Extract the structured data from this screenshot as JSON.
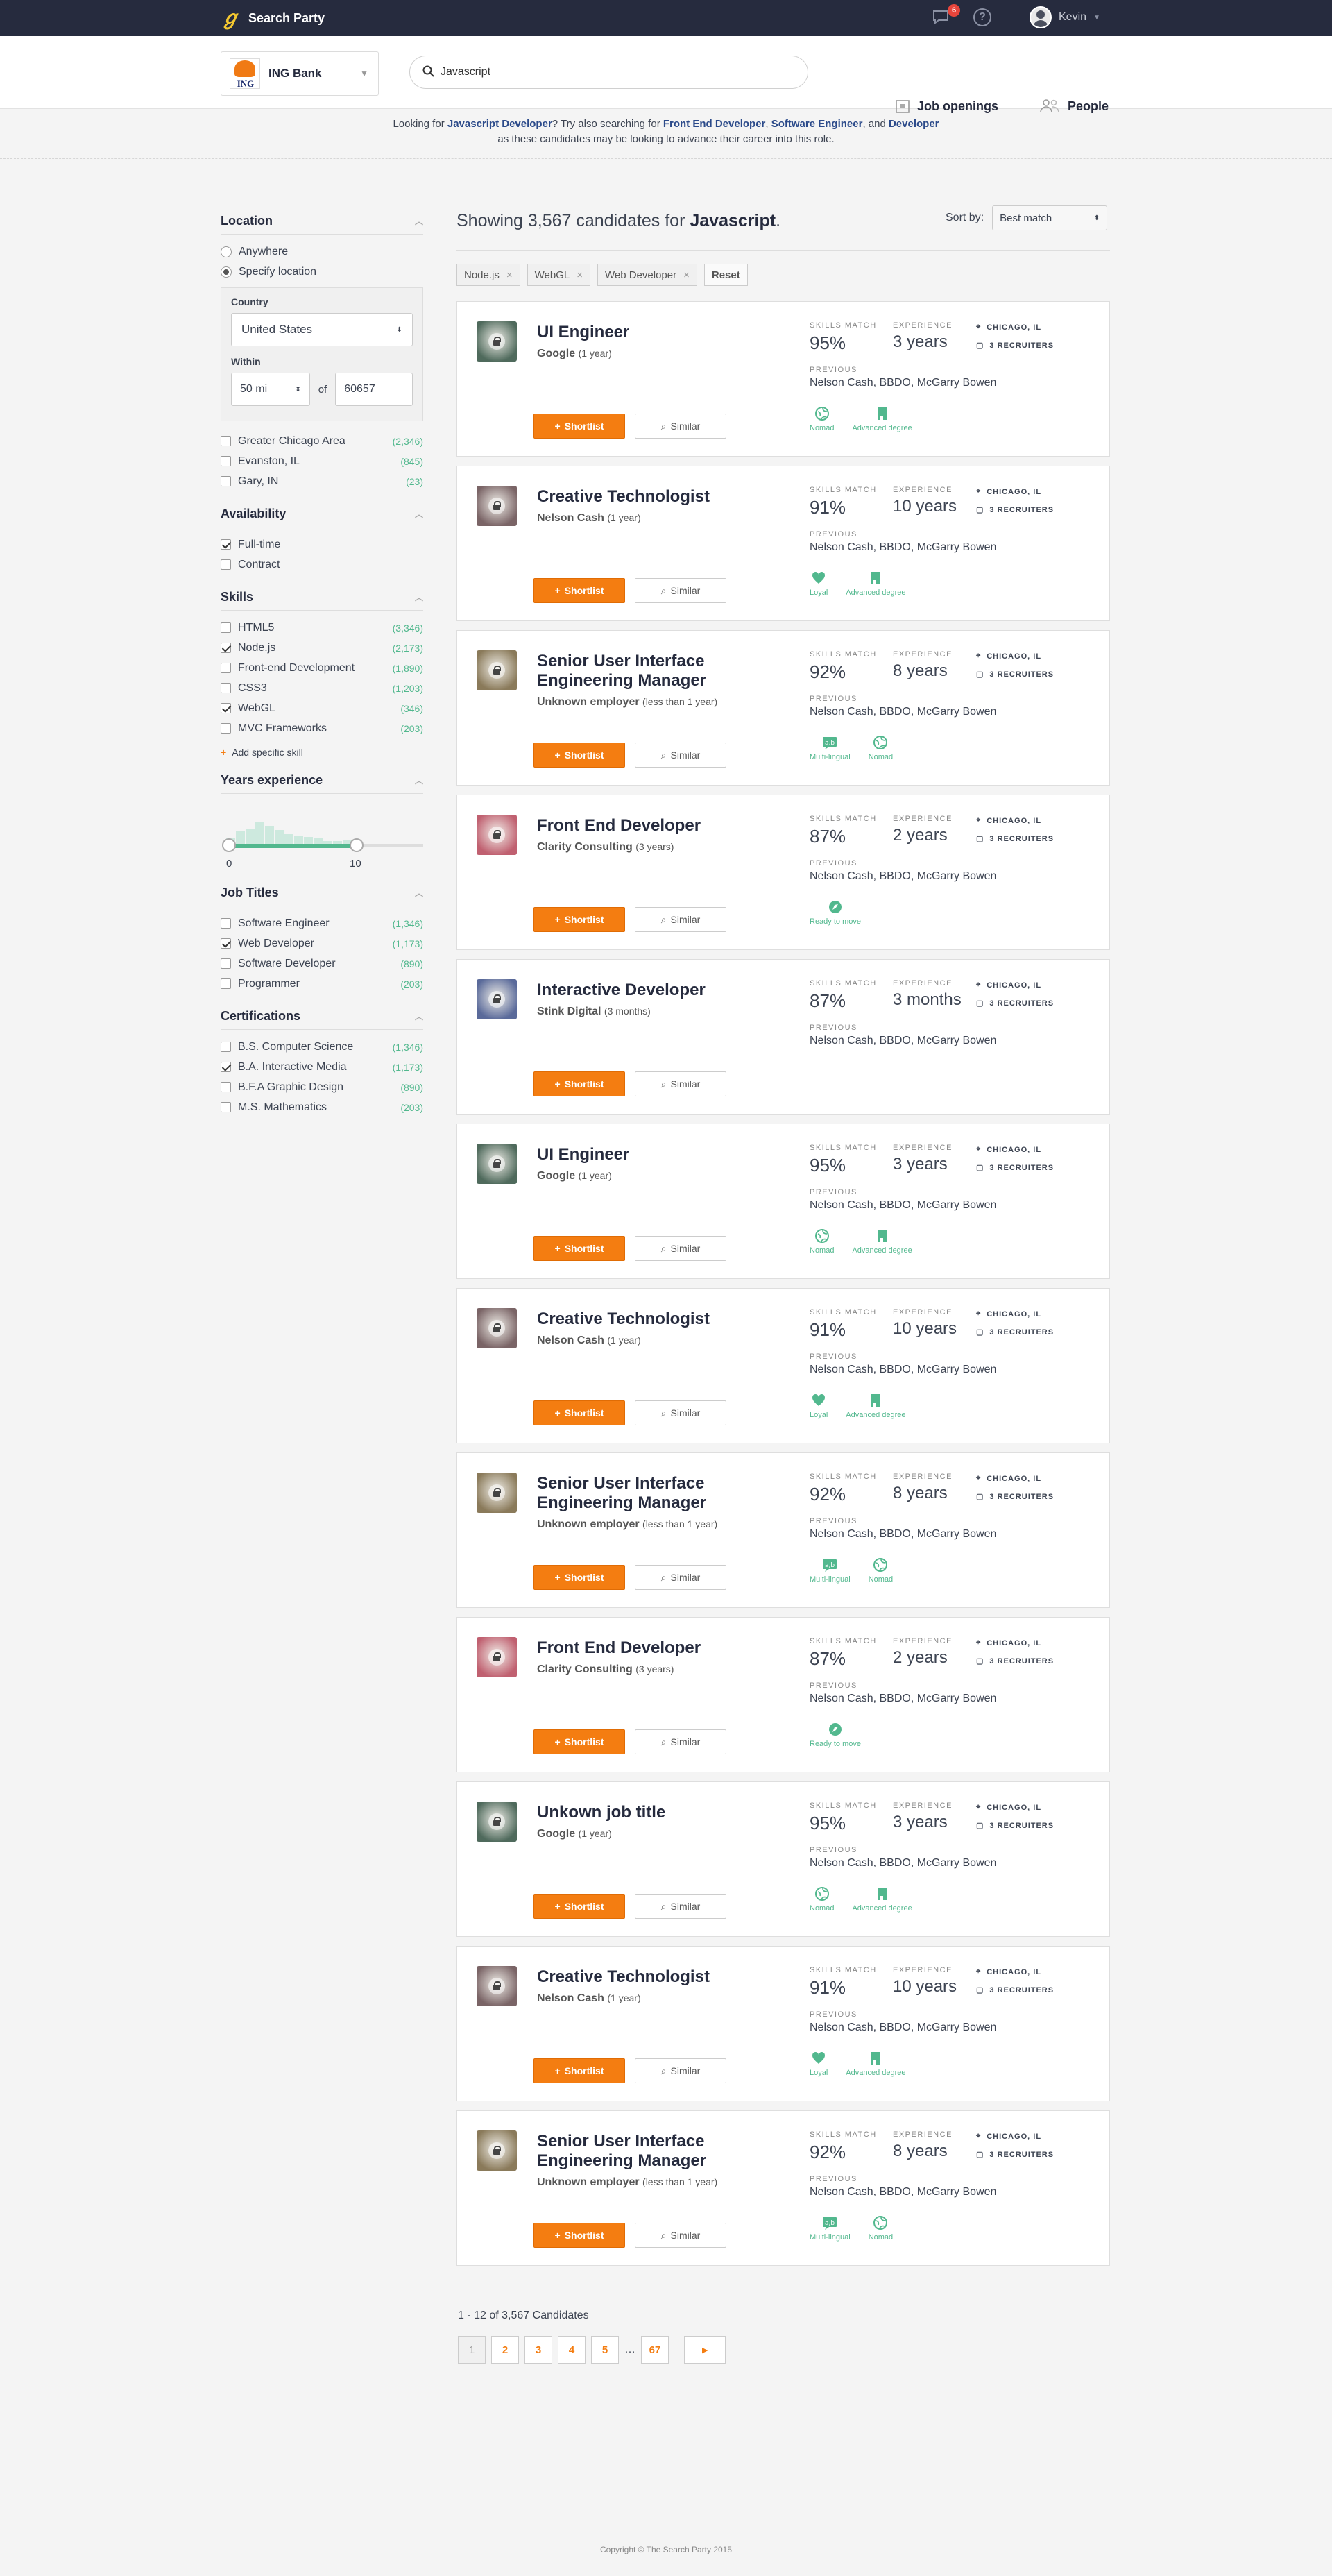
{
  "topbar": {
    "brand": "Search Party",
    "messages_count": "6",
    "help": "?",
    "user": "Kevin"
  },
  "header": {
    "company": {
      "name": "ING Bank",
      "logo_text": "ING"
    },
    "search": {
      "value": "Javascript",
      "placeholder": "Search"
    },
    "nav": {
      "jobs": "Job openings",
      "people": "People"
    }
  },
  "suggestion": {
    "p1": "Looking for ",
    "term": "Javascript Developer",
    "p2": "? Try also searching for ",
    "alt1": "Front End Developer",
    "sep1": ", ",
    "alt2": "Software Engineer",
    "sep2": ", and ",
    "alt3": "Developer",
    "line2": "as these candidates may be looking to advance their career into this role."
  },
  "filters": {
    "location": {
      "title": "Location",
      "options": [
        {
          "label": "Anywhere",
          "selected": false
        },
        {
          "label": "Specify location",
          "selected": true
        }
      ],
      "country_label": "Country",
      "country": "United States",
      "within_label": "Within",
      "within": "50 mi",
      "of": "of",
      "zip": "60657",
      "areas": [
        {
          "label": "Greater Chicago Area",
          "count": "(2,346)"
        },
        {
          "label": "Evanston, IL",
          "count": "(845)"
        },
        {
          "label": "Gary, IN",
          "count": "(23)"
        }
      ]
    },
    "availability": {
      "title": "Availability",
      "items": [
        {
          "label": "Full-time",
          "checked": true
        },
        {
          "label": "Contract",
          "checked": false
        }
      ]
    },
    "skills": {
      "title": "Skills",
      "items": [
        {
          "label": "HTML5",
          "count": "(3,346)",
          "checked": false
        },
        {
          "label": "Node.js",
          "count": "(2,173)",
          "checked": true
        },
        {
          "label": "Front-end Development",
          "count": "(1,890)",
          "checked": false
        },
        {
          "label": "CSS3",
          "count": "(1,203)",
          "checked": false
        },
        {
          "label": "WebGL",
          "count": "(346)",
          "checked": true
        },
        {
          "label": "MVC Frameworks",
          "count": "(203)",
          "checked": false
        }
      ],
      "add": "Add specific skill"
    },
    "years": {
      "title": "Years experience",
      "min": "0",
      "max": "10"
    },
    "job_titles": {
      "title": "Job Titles",
      "items": [
        {
          "label": "Software Engineer",
          "count": "(1,346)",
          "checked": false
        },
        {
          "label": "Web Developer",
          "count": "(1,173)",
          "checked": true
        },
        {
          "label": "Software Developer",
          "count": "(890)",
          "checked": false
        },
        {
          "label": "Programmer",
          "count": "(203)",
          "checked": false
        }
      ]
    },
    "certifications": {
      "title": "Certifications",
      "items": [
        {
          "label": "B.S. Computer Science",
          "count": "(1,346)",
          "checked": false
        },
        {
          "label": "B.A. Interactive Media",
          "count": "(1,173)",
          "checked": true
        },
        {
          "label": "B.F.A Graphic Design",
          "count": "(890)",
          "checked": false
        },
        {
          "label": "M.S. Mathematics",
          "count": "(203)",
          "checked": false
        }
      ]
    }
  },
  "results": {
    "prefix": "Showing ",
    "count": "3,567",
    "mid": " candidates for ",
    "term": "Javascript",
    "suffix": ".",
    "sort_label": "Sort by:",
    "sort_value": "Best match",
    "chips": [
      "Node.js",
      "WebGL",
      "Web Developer"
    ],
    "reset": "Reset"
  },
  "card_labels": {
    "skills_match": "SKILLS MATCH",
    "experience": "EXPERIENCE",
    "previous": "PREVIOUS",
    "shortlist": "Shortlist",
    "similar": "Similar"
  },
  "candidates": [
    {
      "title": "UI Engineer",
      "employer": "Google",
      "tenure": "(1 year)",
      "match": "95%",
      "experience": "3 years",
      "location": "CHICAGO, IL",
      "recruiters": "3 RECRUITERS",
      "previous": "Nelson Cash, BBDO, McGarry Bowen",
      "badges": [
        "Nomad",
        "Advanced degree"
      ],
      "avatar_color": "#4f6a5c"
    },
    {
      "title": "Creative Technologist",
      "employer": "Nelson Cash",
      "tenure": "(1 year)",
      "match": "91%",
      "experience": "10 years",
      "location": "CHICAGO, IL",
      "recruiters": "3 RECRUITERS",
      "previous": "Nelson Cash, BBDO, McGarry Bowen",
      "badges": [
        "Loyal",
        "Advanced degree"
      ],
      "avatar_color": "#7a6466"
    },
    {
      "title": "Senior User Interface Engineering Manager",
      "employer": "Unknown employer",
      "tenure": "(less than 1 year)",
      "match": "92%",
      "experience": "8 years",
      "location": "CHICAGO, IL",
      "recruiters": "3 RECRUITERS",
      "previous": "Nelson Cash, BBDO, McGarry Bowen",
      "badges": [
        "Multi-lingual",
        "Nomad"
      ],
      "avatar_color": "#8a7a5a"
    },
    {
      "title": "Front End Developer",
      "employer": "Clarity Consulting",
      "tenure": "(3 years)",
      "match": "87%",
      "experience": "2 years",
      "location": "CHICAGO, IL",
      "recruiters": "3 RECRUITERS",
      "previous": "Nelson Cash, BBDO, McGarry Bowen",
      "badges": [
        "Ready to move"
      ],
      "avatar_color": "#c06070"
    },
    {
      "title": "Interactive Developer",
      "employer": "Stink Digital",
      "tenure": "(3 months)",
      "match": "87%",
      "experience": "3 months",
      "location": "CHICAGO, IL",
      "recruiters": "3 RECRUITERS",
      "previous": "Nelson Cash, BBDO, McGarry Bowen",
      "badges": [],
      "avatar_color": "#5a6a9a"
    },
    {
      "title": "UI Engineer",
      "employer": "Google",
      "tenure": "(1 year)",
      "match": "95%",
      "experience": "3 years",
      "location": "CHICAGO, IL",
      "recruiters": "3 RECRUITERS",
      "previous": "Nelson Cash, BBDO, McGarry Bowen",
      "badges": [
        "Nomad",
        "Advanced degree"
      ],
      "avatar_color": "#4f6a5c"
    },
    {
      "title": "Creative Technologist",
      "employer": "Nelson Cash",
      "tenure": "(1 year)",
      "match": "91%",
      "experience": "10 years",
      "location": "CHICAGO, IL",
      "recruiters": "3 RECRUITERS",
      "previous": "Nelson Cash, BBDO, McGarry Bowen",
      "badges": [
        "Loyal",
        "Advanced degree"
      ],
      "avatar_color": "#7a6466"
    },
    {
      "title": "Senior User Interface Engineering Manager",
      "employer": "Unknown employer",
      "tenure": "(less than 1 year)",
      "match": "92%",
      "experience": "8 years",
      "location": "CHICAGO, IL",
      "recruiters": "3 RECRUITERS",
      "previous": "Nelson Cash, BBDO, McGarry Bowen",
      "badges": [
        "Multi-lingual",
        "Nomad"
      ],
      "avatar_color": "#8a7a5a"
    },
    {
      "title": "Front End Developer",
      "employer": "Clarity Consulting",
      "tenure": "(3 years)",
      "match": "87%",
      "experience": "2 years",
      "location": "CHICAGO, IL",
      "recruiters": "3 RECRUITERS",
      "previous": "Nelson Cash, BBDO, McGarry Bowen",
      "badges": [
        "Ready to move"
      ],
      "avatar_color": "#c06070"
    },
    {
      "title": "Unkown job title",
      "employer": "Google",
      "tenure": "(1 year)",
      "match": "95%",
      "experience": "3 years",
      "location": "CHICAGO, IL",
      "recruiters": "3 RECRUITERS",
      "previous": "Nelson Cash, BBDO, McGarry Bowen",
      "badges": [
        "Nomad",
        "Advanced degree"
      ],
      "avatar_color": "#4f6a5c"
    },
    {
      "title": "Creative Technologist",
      "employer": "Nelson Cash",
      "tenure": "(1 year)",
      "match": "91%",
      "experience": "10 years",
      "location": "CHICAGO, IL",
      "recruiters": "3 RECRUITERS",
      "previous": "Nelson Cash, BBDO, McGarry Bowen",
      "badges": [
        "Loyal",
        "Advanced degree"
      ],
      "avatar_color": "#7a6466"
    },
    {
      "title": "Senior User Interface Engineering Manager",
      "employer": "Unknown employer",
      "tenure": "(less than 1 year)",
      "match": "92%",
      "experience": "8 years",
      "location": "CHICAGO, IL",
      "recruiters": "3 RECRUITERS",
      "previous": "Nelson Cash, BBDO, McGarry Bowen",
      "badges": [
        "Multi-lingual",
        "Nomad"
      ],
      "avatar_color": "#8a7a5a"
    }
  ],
  "pagination": {
    "info": "1 - 12 of 3,567 Candidates",
    "pages": [
      "1",
      "2",
      "3",
      "4",
      "5",
      "…",
      "67"
    ],
    "current": "1",
    "next": "▸"
  },
  "footer": "Copyright © The Search Party 2015",
  "colors": {
    "accent": "#f47d11",
    "green": "#52b88e",
    "navy": "#262b3e"
  }
}
